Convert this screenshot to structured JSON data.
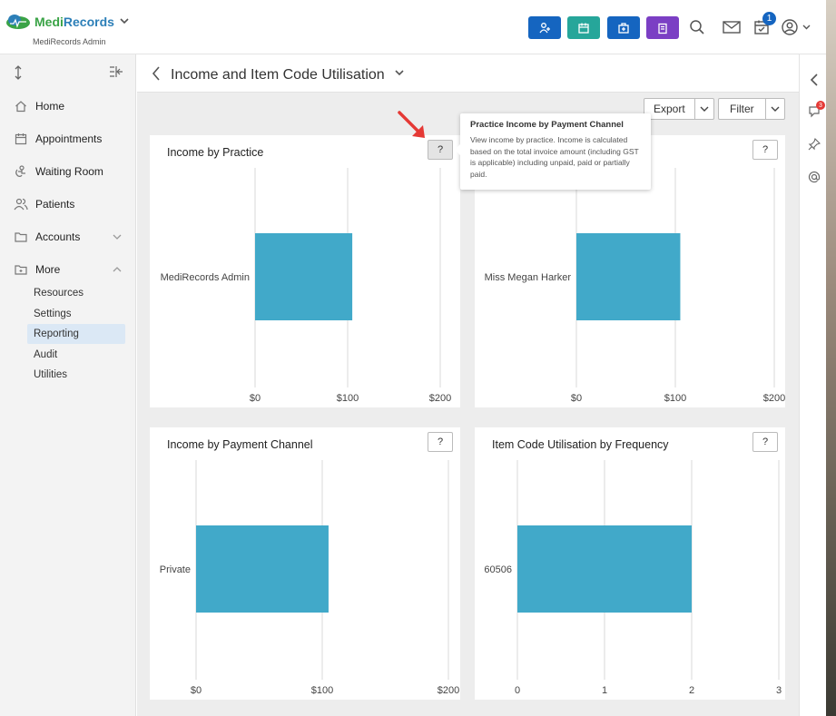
{
  "app": {
    "brand_part1": "Medi",
    "brand_part2": "Records",
    "subtitle": "MediRecords Admin",
    "notifications_count": "1",
    "chat_badge": "3"
  },
  "sidebar": {
    "items": [
      {
        "label": "Home",
        "icon": "home-icon"
      },
      {
        "label": "Appointments",
        "icon": "calendar-icon"
      },
      {
        "label": "Waiting Room",
        "icon": "waiting-room-icon"
      },
      {
        "label": "Patients",
        "icon": "patients-icon"
      },
      {
        "label": "Accounts",
        "icon": "folder-icon"
      },
      {
        "label": "More",
        "icon": "more-folder-icon"
      }
    ],
    "sub_items": [
      {
        "label": "Resources"
      },
      {
        "label": "Settings"
      },
      {
        "label": "Reporting"
      },
      {
        "label": "Audit"
      },
      {
        "label": "Utilities"
      }
    ],
    "active_sub_item": "Reporting"
  },
  "page": {
    "title": "Income and Item Code Utilisation",
    "export_label": "Export",
    "filter_label": "Filter"
  },
  "tooltip": {
    "title": "Practice Income by Payment Channel",
    "body": "View income by practice. Income is calculated based on the total invoice amount (including GST is applicable) including unpaid, paid or partially paid."
  },
  "help_label": "?",
  "colors": {
    "bar": "#41a9c9",
    "btn_blue": "#1565c0",
    "btn_teal": "#26a69a",
    "btn_purple": "#7b3fc4"
  },
  "chart_data": [
    {
      "type": "bar",
      "orientation": "horizontal",
      "title": "Income by Practice",
      "categories": [
        "MediRecords Admin"
      ],
      "values": [
        105
      ],
      "xticks": [
        "$0",
        "$100",
        "$200"
      ],
      "xlim": [
        0,
        200
      ]
    },
    {
      "type": "bar",
      "orientation": "horizontal",
      "title": "",
      "categories": [
        "Miss Megan Harker"
      ],
      "values": [
        105
      ],
      "xticks": [
        "$0",
        "$100",
        "$200"
      ],
      "xlim": [
        0,
        200
      ]
    },
    {
      "type": "bar",
      "orientation": "horizontal",
      "title": "Income by Payment Channel",
      "categories": [
        "Private"
      ],
      "values": [
        105
      ],
      "xticks": [
        "$0",
        "$100",
        "$200"
      ],
      "xlim": [
        0,
        200
      ]
    },
    {
      "type": "bar",
      "orientation": "horizontal",
      "title": "Item Code Utilisation by Frequency",
      "categories": [
        "60506"
      ],
      "values": [
        2
      ],
      "xticks": [
        "0",
        "1",
        "2",
        "3"
      ],
      "xlim": [
        0,
        3
      ]
    }
  ]
}
